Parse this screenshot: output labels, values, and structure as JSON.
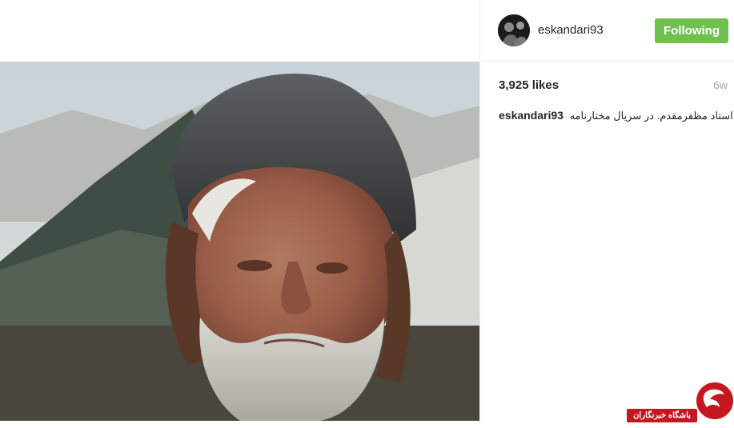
{
  "post": {
    "image_alt": "Portrait of an elderly bearded man wearing a dark metal helmet in front of desert tents"
  },
  "header": {
    "username": "eskandari93",
    "follow_label": "Following",
    "follow_color": "#70c050"
  },
  "stats": {
    "likes": "3,925 likes",
    "time_ago": "6w"
  },
  "caption": {
    "username": "eskandari93",
    "text": "استاد مظفرمقدم. در سریال مختارنامه"
  },
  "watermark": {
    "text": "باشگاه خبرنگاران",
    "color": "#c41820"
  }
}
